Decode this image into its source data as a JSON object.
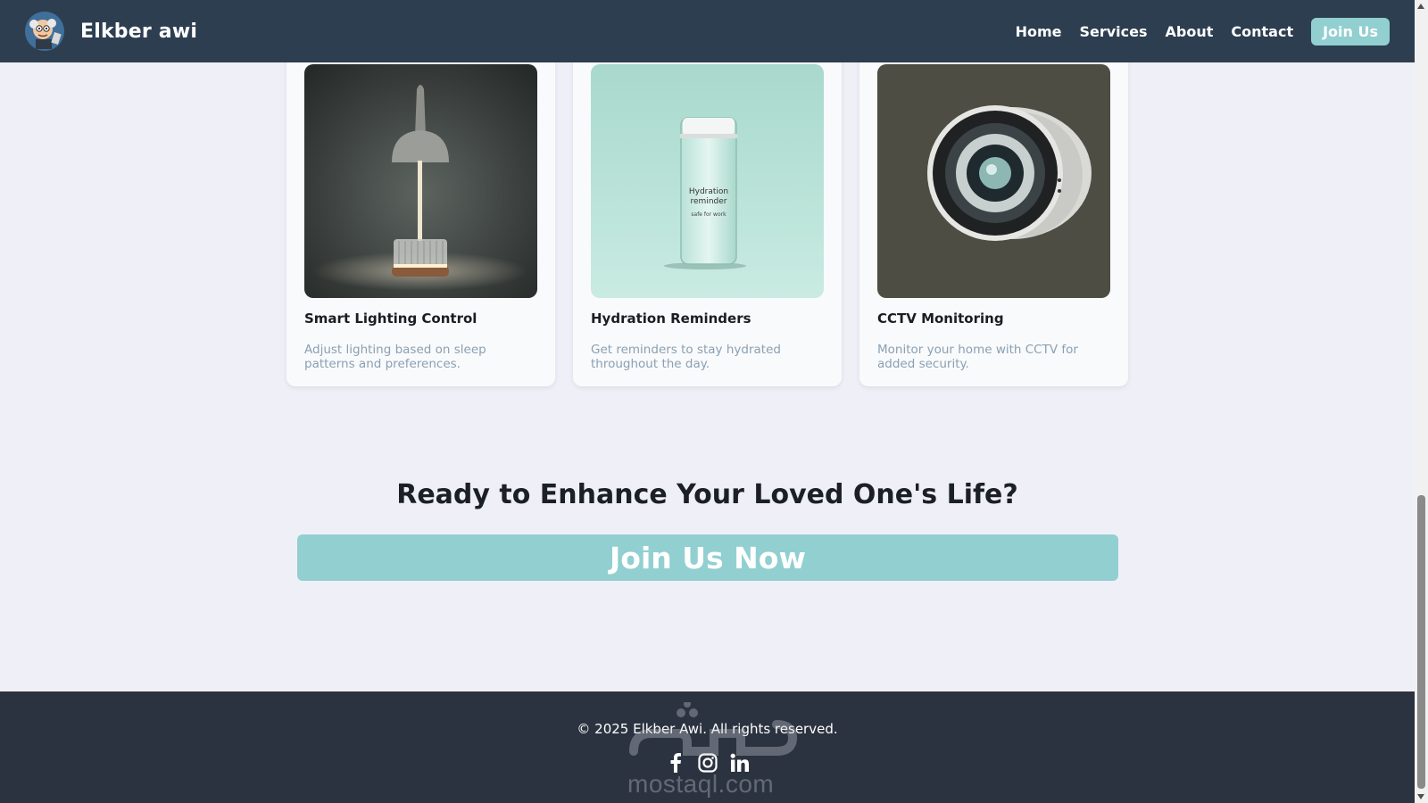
{
  "header": {
    "brand": "Elkber awi",
    "logo_icon": "cartoon-elder-icon",
    "nav": [
      "Home",
      "Services",
      "About",
      "Contact"
    ],
    "join_label": "Join Us"
  },
  "services": [
    {
      "title": "Smart Lighting Control",
      "description": "Adjust lighting based on sleep patterns and preferences.",
      "image": "lamp-image"
    },
    {
      "title": "Hydration Reminders",
      "description": "Get reminders to stay hydrated throughout the day.",
      "image": "water-bottle-image",
      "bottle_text": [
        "Hydration",
        "reminder",
        "safe for work"
      ]
    },
    {
      "title": "CCTV Monitoring",
      "description": "Monitor your home with CCTV for added security.",
      "image": "cctv-camera-image"
    }
  ],
  "cta": {
    "title": "Ready to Enhance Your Loved One's Life?",
    "button_label": "Join Us Now"
  },
  "footer": {
    "copyright": "© 2025 Elkber Awi. All rights reserved.",
    "socials": [
      "facebook-icon",
      "instagram-icon",
      "linkedin-icon"
    ],
    "watermark": "mostaql.com"
  },
  "colors": {
    "navbar": "#2c3e50",
    "accent": "#92cfd0",
    "page_bg": "#eff0f7",
    "footer": "#2c3340",
    "muted_text": "#8aa0b2"
  }
}
